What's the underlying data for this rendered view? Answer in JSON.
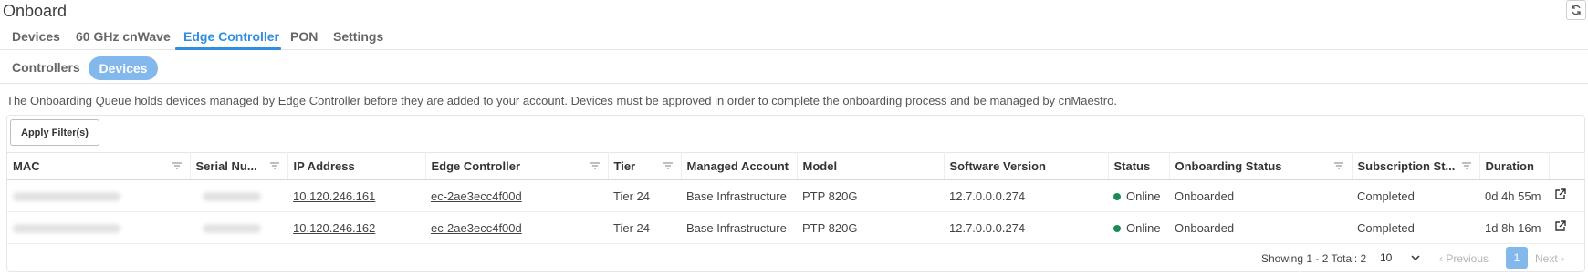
{
  "page": {
    "title": "Onboard"
  },
  "tabs": [
    {
      "label": "Devices",
      "active": false
    },
    {
      "label": "60 GHz cnWave",
      "active": false
    },
    {
      "label": "Edge Controller",
      "active": true
    },
    {
      "label": "PON",
      "active": false
    },
    {
      "label": "Settings",
      "active": false
    }
  ],
  "subtabs": [
    {
      "label": "Controllers",
      "active": false
    },
    {
      "label": "Devices",
      "active": true
    }
  ],
  "description": "The Onboarding Queue holds devices managed by Edge Controller before they are added to your account. Devices must be approved in order to complete the onboarding process and be managed by cnMaestro.",
  "toolbar": {
    "apply_filters_label": "Apply Filter(s)"
  },
  "table": {
    "columns": [
      "MAC",
      "Serial Nu...",
      "IP Address",
      "Edge Controller",
      "Tier",
      "Managed Account",
      "Model",
      "Software Version",
      "Status",
      "Onboarding Status",
      "Subscription St...",
      "Duration"
    ],
    "rows": [
      {
        "ip": "10.120.246.161",
        "edge_controller": "ec-2ae3ecc4f00d",
        "tier": "Tier 24",
        "managed_account": "Base Infrastructure",
        "model": "PTP 820G",
        "software_version": "12.7.0.0.0.274",
        "status": "Online",
        "onboarding_status": "Onboarded",
        "subscription_status": "Completed",
        "duration": "0d 4h 55m"
      },
      {
        "ip": "10.120.246.162",
        "edge_controller": "ec-2ae3ecc4f00d",
        "tier": "Tier 24",
        "managed_account": "Base Infrastructure",
        "model": "PTP 820G",
        "software_version": "12.7.0.0.0.274",
        "status": "Online",
        "onboarding_status": "Onboarded",
        "subscription_status": "Completed",
        "duration": "1d 8h 16m"
      }
    ]
  },
  "pagination": {
    "showing_text": "Showing 1 - 2 Total: 2",
    "page_size": "10",
    "previous_label": "Previous",
    "next_label": "Next",
    "current_page": "1"
  },
  "colors": {
    "accent": "#2f8ee0",
    "pill": "#82b8ec",
    "online": "#1b8a5a"
  },
  "icons": [
    "refresh-icon",
    "filter-icon",
    "external-link-icon",
    "chevron-down-icon",
    "chevron-left-icon",
    "chevron-right-icon"
  ]
}
